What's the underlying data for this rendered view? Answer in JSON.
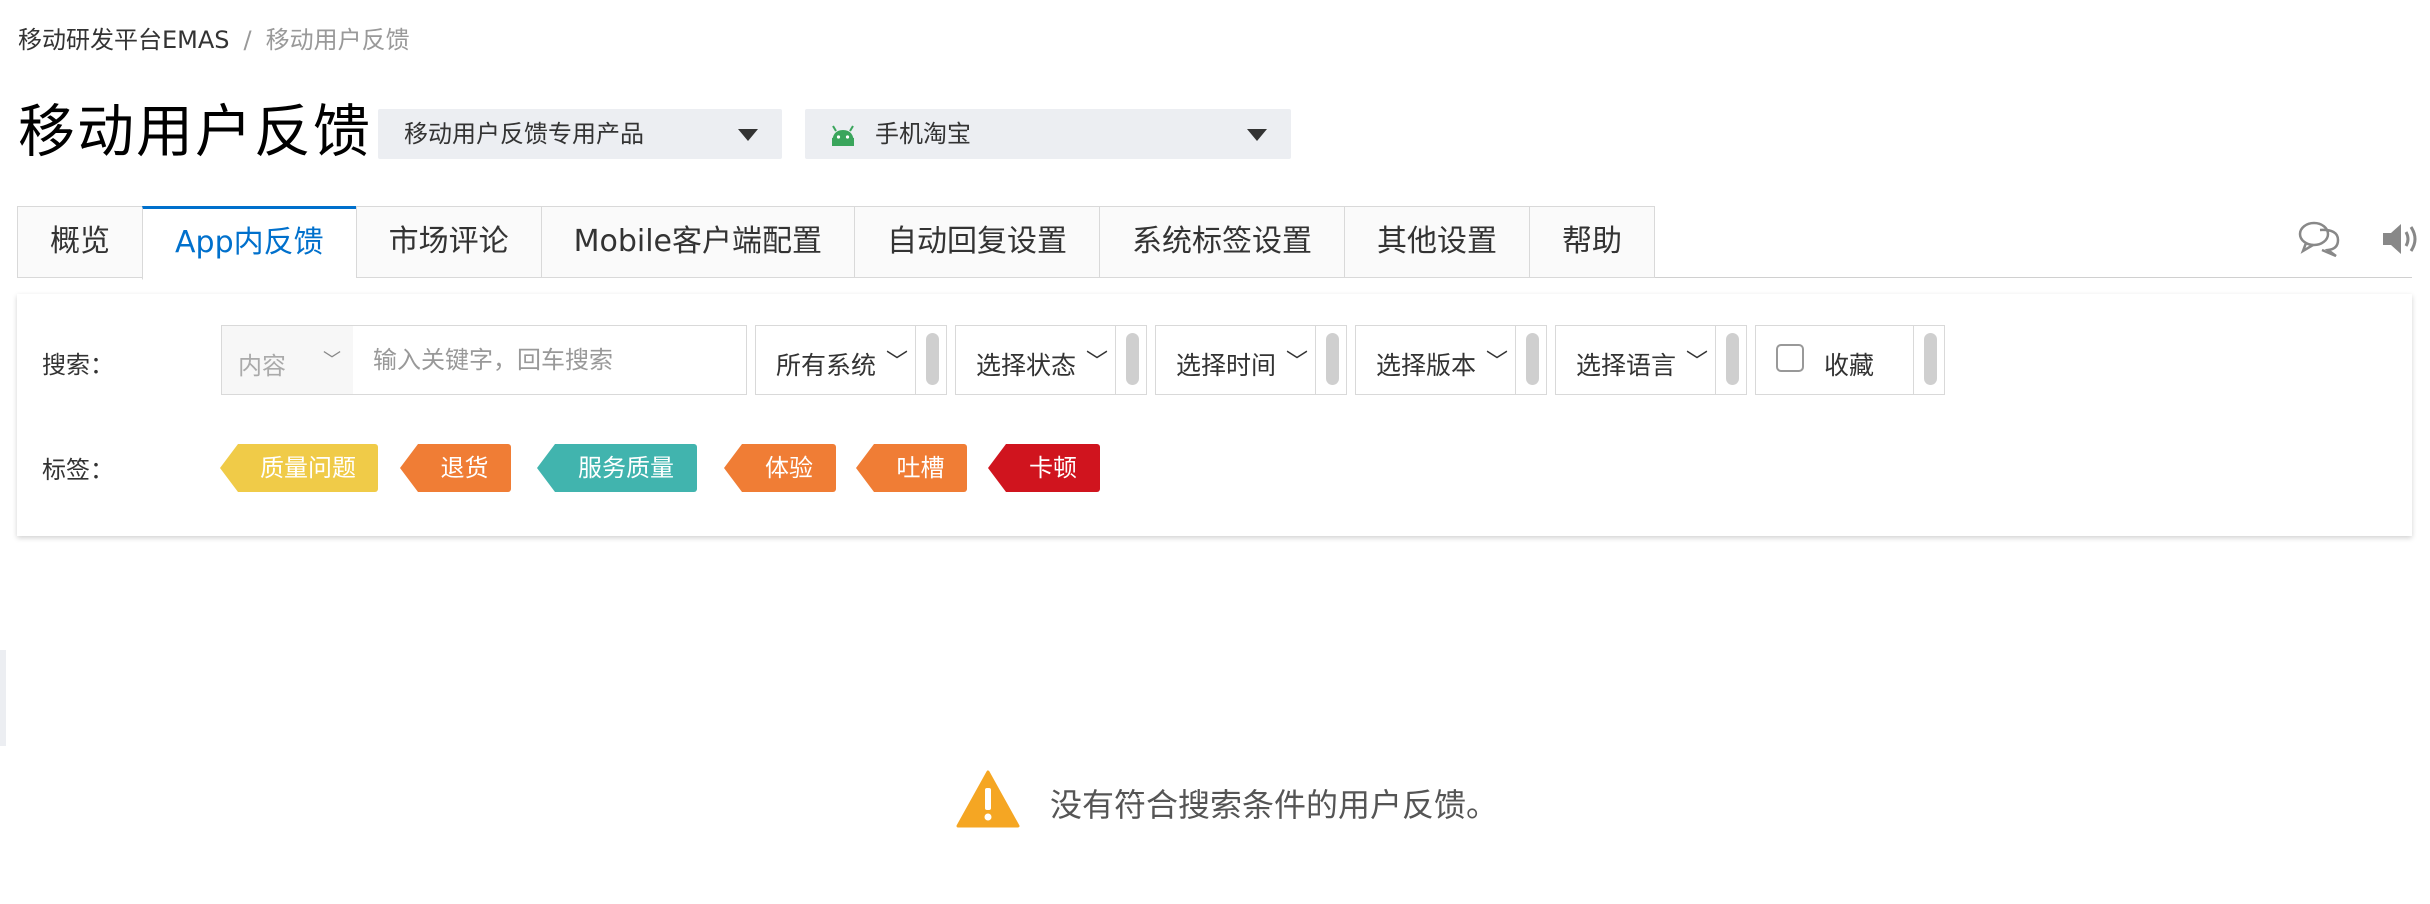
{
  "breadcrumb": {
    "root": "移动研发平台EMAS",
    "separator": "/",
    "current": "移动用户反馈"
  },
  "page_title": "移动用户反馈",
  "product_select": {
    "value": "移动用户反馈专用产品"
  },
  "app_select": {
    "value": "手机淘宝",
    "icon": "android-icon"
  },
  "tabs": [
    {
      "label": "概览",
      "active": false
    },
    {
      "label": "App内反馈",
      "active": true
    },
    {
      "label": "市场评论",
      "active": false
    },
    {
      "label": "Mobile客户端配置",
      "active": false
    },
    {
      "label": "自动回复设置",
      "active": false
    },
    {
      "label": "系统标签设置",
      "active": false
    },
    {
      "label": "其他设置",
      "active": false
    },
    {
      "label": "帮助",
      "active": false
    }
  ],
  "toolbar_icons": [
    "chat-icon",
    "speaker-icon"
  ],
  "search": {
    "label": "搜索：",
    "type_value": "内容",
    "placeholder": "输入关键字，回车搜索"
  },
  "filters": {
    "system": "所有系统",
    "status": "选择状态",
    "time": "选择时间",
    "version": "选择版本",
    "language": "选择语言",
    "favorite": "收藏"
  },
  "tags_section": {
    "label": "标签：",
    "tags": [
      {
        "label": "质量问题",
        "color": "#f0cb48"
      },
      {
        "label": "退货",
        "color": "#f07d35"
      },
      {
        "label": "服务质量",
        "color": "#41b4ae"
      },
      {
        "label": "体验",
        "color": "#f07d35"
      },
      {
        "label": "吐槽",
        "color": "#f07d35"
      },
      {
        "label": "卡顿",
        "color": "#d0141e"
      }
    ]
  },
  "empty_state": {
    "message": "没有符合搜索条件的用户反馈。",
    "icon": "warning-icon",
    "color": "#f5a623"
  }
}
